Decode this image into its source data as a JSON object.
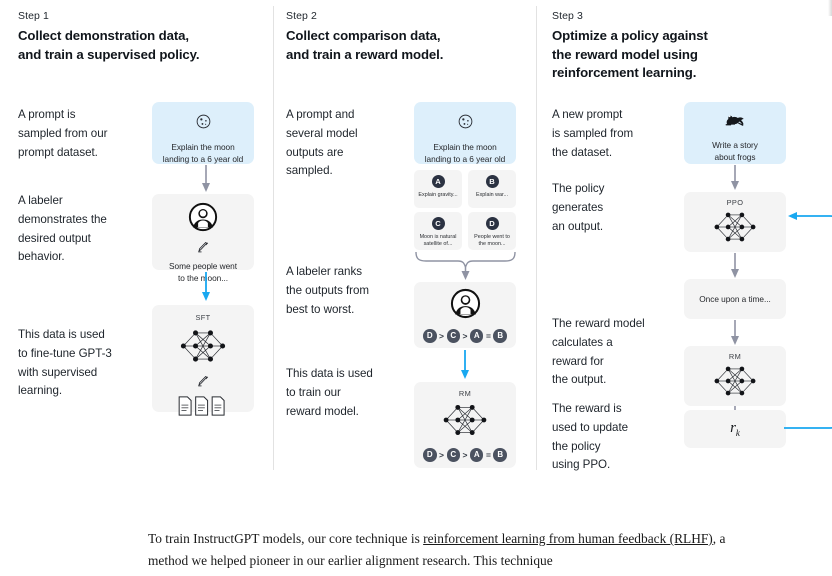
{
  "steps": [
    {
      "label": "Step 1",
      "title": "Collect demonstration data,\nand train a supervised policy.",
      "paragraphs": [
        "A prompt is\nsampled from our\nprompt dataset.",
        "A labeler\ndemonstrates the\ndesired output\nbehavior.",
        "This data is used\nto fine-tune GPT-3\nwith supervised\nlearning."
      ],
      "prompt_card": {
        "icon": "moon-icon",
        "text": "Explain the moon\nlanding to a 6 year old"
      },
      "labeler_card": {
        "icon": "labeler-avatar-icon",
        "pencil": "pencil-icon",
        "text": "Some people went\nto the moon..."
      },
      "model_card": {
        "caption": "SFT",
        "icon": "neural-network-icon",
        "pencil": "pencil-icon",
        "docs": "documents-icon"
      }
    },
    {
      "label": "Step 2",
      "title": "Collect comparison data,\nand train a reward model.",
      "paragraphs": [
        "A prompt and\nseveral model\noutputs are\nsampled.",
        "A labeler ranks\nthe outputs from\nbest to worst.",
        "This data is used\nto train our\nreward model."
      ],
      "prompt_card": {
        "icon": "moon-icon",
        "text": "Explain the moon\nlanding to a 6 year old"
      },
      "options": [
        {
          "badge": "A",
          "text": "Explain gravity..."
        },
        {
          "badge": "B",
          "text": "Explain war..."
        },
        {
          "badge": "C",
          "text": "Moon is natural\nsatellite of..."
        },
        {
          "badge": "D",
          "text": "People went to\nthe moon..."
        }
      ],
      "ranking_card": {
        "icon": "labeler-avatar-icon",
        "ranking": [
          "D",
          ">",
          "C",
          ">",
          "A",
          "=",
          "B"
        ]
      },
      "reward_card": {
        "caption": "RM",
        "icon": "neural-network-icon",
        "ranking": [
          "D",
          ">",
          "C",
          ">",
          "A",
          "=",
          "B"
        ]
      }
    },
    {
      "label": "Step 3",
      "title": "Optimize a policy against\nthe reward model using\nreinforcement learning.",
      "paragraphs": [
        "A new prompt\nis sampled from\nthe dataset.",
        "The policy\ngenerates\nan output.",
        "The reward model\ncalculates a\nreward for\nthe output.",
        "The reward is\nused to update\nthe policy\nusing PPO."
      ],
      "prompt_card": {
        "icon": "frog-icon",
        "text": "Write a story\nabout frogs"
      },
      "policy_card": {
        "caption": "PPO",
        "icon": "neural-network-icon"
      },
      "output_card": {
        "text": "Once upon a time..."
      },
      "reward_card": {
        "caption": "RM",
        "icon": "neural-network-icon"
      },
      "reward_value_card": {
        "symbol": "r",
        "subscript": "k"
      }
    }
  ],
  "colors": {
    "prompt_card_bg": "#ddeffb",
    "card_bg": "#f4f4f4",
    "blue_arrow": "#19a8f0",
    "gray_arrow": "#8f93a3",
    "badge_bg": "#2b3242",
    "divider": "#e2e2e2"
  },
  "footer": {
    "text_before": "To train InstructGPT models, our core technique is ",
    "link_text": "reinforcement learning from human feedback (RLHF)",
    "text_after": ", a method we helped pioneer in our earlier alignment research. This technique"
  }
}
